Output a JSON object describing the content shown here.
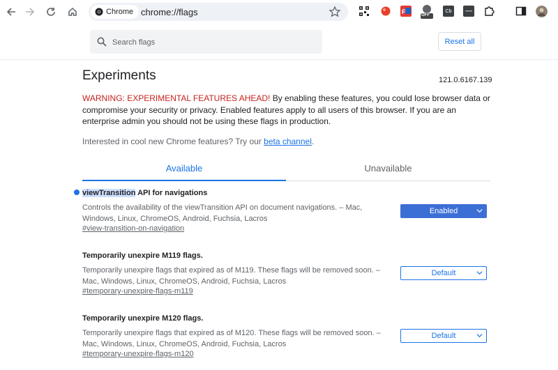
{
  "toolbar": {
    "chip_label": "Chrome",
    "url": "chrome://flags",
    "ext_cb_label": "Cb",
    "ext_off_label": "OFF"
  },
  "search": {
    "placeholder": "Search flags",
    "reset_label": "Reset all"
  },
  "header": {
    "title": "Experiments",
    "version": "121.0.6167.139"
  },
  "warning": {
    "head": "WARNING: EXPERIMENTAL FEATURES AHEAD!",
    "body": " By enabling these features, you could lose browser data or compromise your security or privacy. Enabled features apply to all users of this browser. If you are an enterprise admin you should not be using these flags in production."
  },
  "interest": {
    "text": "Interested in cool new Chrome features? Try our ",
    "link": "beta channel",
    "suffix": "."
  },
  "tabs": {
    "available": "Available",
    "unavailable": "Unavailable"
  },
  "flags": [
    {
      "title_highlight": "viewTransition",
      "title_rest": " API for navigations",
      "desc": "Controls the availability of the viewTransition API on document navigations. – Mac, Windows, Linux, ChromeOS, Android, Fuchsia, Lacros",
      "link": "#view-transition-on-navigation",
      "value": "Enabled"
    },
    {
      "title": "Temporarily unexpire M119 flags.",
      "desc": "Temporarily unexpire flags that expired as of M119. These flags will be removed soon. – Mac, Windows, Linux, ChromeOS, Android, Fuchsia, Lacros",
      "link": "#temporary-unexpire-flags-m119",
      "value": "Default"
    },
    {
      "title": "Temporarily unexpire M120 flags.",
      "desc": "Temporarily unexpire flags that expired as of M120. These flags will be removed soon. – Mac, Windows, Linux, ChromeOS, Android, Fuchsia, Lacros",
      "link": "#temporary-unexpire-flags-m120",
      "value": "Default"
    }
  ],
  "colors": {
    "accent": "#1a73e8",
    "warning": "#c5221f",
    "enabled_bg": "#3c6fd6"
  }
}
